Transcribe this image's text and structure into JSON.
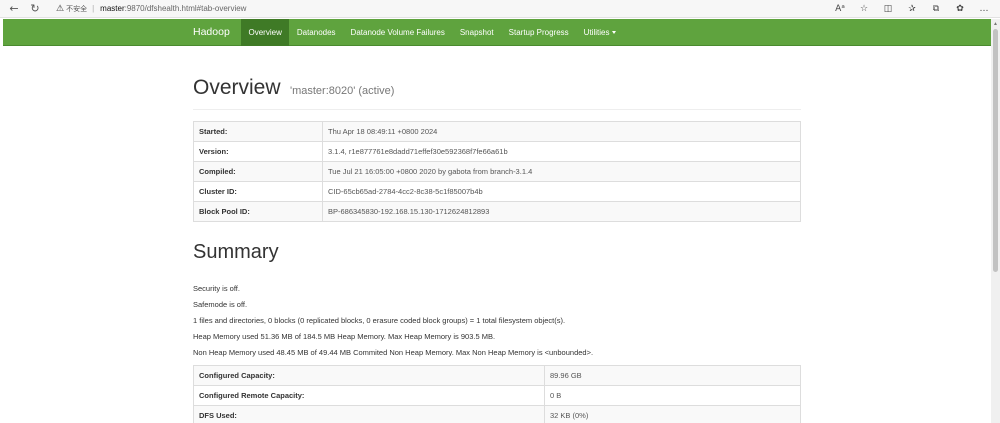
{
  "browser": {
    "insecure_label": "不安全",
    "separator": "|",
    "url_host": "master",
    "url_rest": ":9870/dfshealth.html#tab-overview"
  },
  "navbar": {
    "brand": "Hadoop",
    "items": [
      {
        "label": "Overview",
        "active": true
      },
      {
        "label": "Datanodes"
      },
      {
        "label": "Datanode Volume Failures"
      },
      {
        "label": "Snapshot"
      },
      {
        "label": "Startup Progress"
      },
      {
        "label": "Utilities"
      }
    ],
    "brand_color": "#5fa33e",
    "active_color": "#3f7a26"
  },
  "overview": {
    "title": "Overview",
    "subtitle": "'master:8020' (active)",
    "rows": [
      {
        "label": "Started:",
        "value": "Thu Apr 18 08:49:11 +0800 2024"
      },
      {
        "label": "Version:",
        "value": "3.1.4, r1e877761e8dadd71effef30e592368f7fe66a61b"
      },
      {
        "label": "Compiled:",
        "value": "Tue Jul 21 16:05:00 +0800 2020 by gabota from branch-3.1.4"
      },
      {
        "label": "Cluster ID:",
        "value": "CID-65cb65ad-2784-4cc2-8c38-5c1f85007b4b"
      },
      {
        "label": "Block Pool ID:",
        "value": "BP-686345830-192.168.15.130-1712624812893"
      }
    ]
  },
  "summary": {
    "title": "Summary",
    "lines": [
      "Security is off.",
      "Safemode is off.",
      "1 files and directories, 0 blocks (0 replicated blocks, 0 erasure coded block groups) = 1 total filesystem object(s).",
      "Heap Memory used 51.36 MB of 184.5 MB Heap Memory. Max Heap Memory is 903.5 MB.",
      "Non Heap Memory used 48.45 MB of 49.44 MB Commited Non Heap Memory. Max Non Heap Memory is <unbounded>."
    ],
    "rows": [
      {
        "label": "Configured Capacity:",
        "value": "89.96 GB"
      },
      {
        "label": "Configured Remote Capacity:",
        "value": "0 B"
      },
      {
        "label": "DFS Used:",
        "value": "32 KB (0%)"
      }
    ]
  }
}
